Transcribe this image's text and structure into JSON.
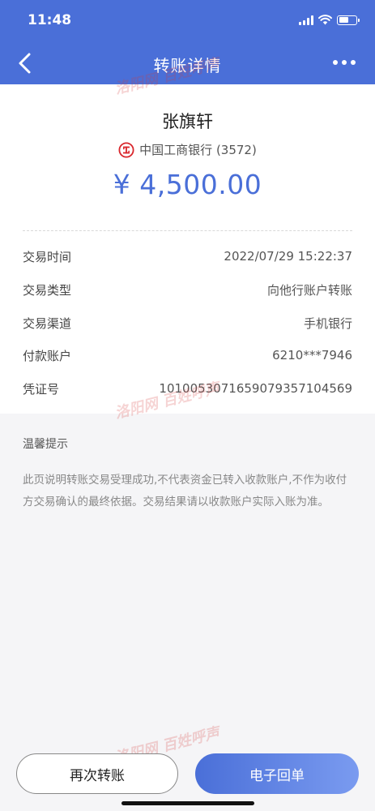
{
  "status_bar": {
    "time": "11:48",
    "battery_level": 0.55
  },
  "nav": {
    "title": "转账详情"
  },
  "transfer": {
    "payee_name": "张旗轩",
    "bank": "中国工商银行 (3572)",
    "amount": "¥ 4,500.00"
  },
  "details": [
    {
      "label": "交易时间",
      "value": "2022/07/29 15:22:37"
    },
    {
      "label": "交易类型",
      "value": "向他行账户转账"
    },
    {
      "label": "交易渠道",
      "value": "手机银行"
    },
    {
      "label": "付款账户",
      "value": "6210***7946"
    },
    {
      "label": "凭证号",
      "value": "1010053071659079357104569"
    }
  ],
  "tips": {
    "title": "温馨提示",
    "body": "此页说明转账交易受理成功,不代表资金已转入收款账户,不作为收付方交易确认的最终依据。交易结果请以收款账户实际入账为准。"
  },
  "watermark": {
    "text": "洛阳网 百姓呼声"
  },
  "actions": {
    "retry_label": "再次转账",
    "receipt_label": "电子回单"
  },
  "colors": {
    "brand": "#4a6fd8",
    "amount": "#4a6fd8"
  }
}
